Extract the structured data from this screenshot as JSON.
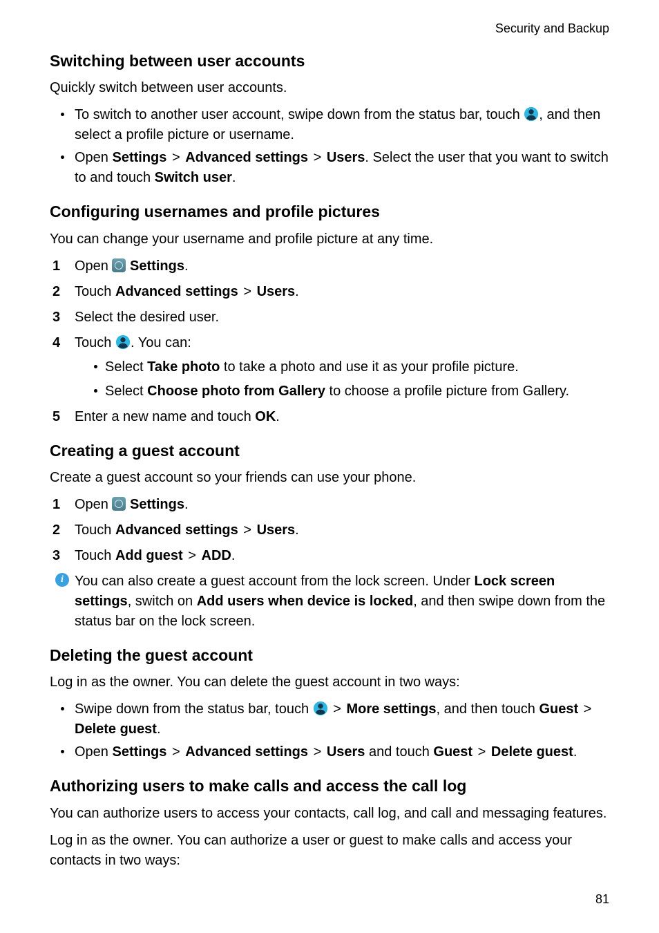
{
  "header": {
    "section": "Security and Backup"
  },
  "page_number": "81",
  "sections": {
    "switching": {
      "title": "Switching between user accounts",
      "intro": "Quickly switch between user accounts.",
      "bullet1_pre": "To switch to another user account, swipe down from the status bar, touch ",
      "bullet1_post": ", and then select a profile picture or username.",
      "bullet2_a": "Open ",
      "bullet2_b": "Settings",
      "bullet2_c": "Advanced settings",
      "bullet2_d": "Users",
      "bullet2_e": ". Select the user that you want to switch to and touch ",
      "bullet2_f": "Switch user",
      "bullet2_g": "."
    },
    "configuring": {
      "title": "Configuring usernames and profile pictures",
      "intro": "You can change your username and profile picture at any time.",
      "step1_a": "Open ",
      "step1_b": "Settings",
      "step1_c": ".",
      "step2_a": "Touch ",
      "step2_b": "Advanced settings",
      "step2_c": "Users",
      "step2_d": ".",
      "step3": "Select the desired user.",
      "step4_a": "Touch ",
      "step4_b": ". You can:",
      "step4_sub1_a": "Select ",
      "step4_sub1_b": "Take photo",
      "step4_sub1_c": " to take a photo and use it as your profile picture.",
      "step4_sub2_a": "Select ",
      "step4_sub2_b": "Choose photo from Gallery",
      "step4_sub2_c": " to choose a profile picture from Gallery.",
      "step5_a": "Enter a new name and touch ",
      "step5_b": "OK",
      "step5_c": "."
    },
    "creating": {
      "title": "Creating a guest account",
      "intro": "Create a guest account so your friends can use your phone.",
      "step1_a": "Open ",
      "step1_b": "Settings",
      "step1_c": ".",
      "step2_a": "Touch ",
      "step2_b": "Advanced settings",
      "step2_c": "Users",
      "step2_d": ".",
      "step3_a": "Touch ",
      "step3_b": "Add guest",
      "step3_c": "ADD",
      "step3_d": ".",
      "note_a": "You can also create a guest account from the lock screen. Under ",
      "note_b": "Lock screen settings",
      "note_c": ", switch on ",
      "note_d": "Add users when device is locked",
      "note_e": ", and then swipe down from the status bar on the lock screen."
    },
    "deleting": {
      "title": "Deleting the guest account",
      "intro": "Log in as the owner. You can delete the guest account in two ways:",
      "bullet1_a": "Swipe down from the status bar, touch ",
      "bullet1_b": "More settings",
      "bullet1_c": ", and then touch ",
      "bullet1_d": "Guest",
      "bullet1_e": "Delete guest",
      "bullet1_f": ".",
      "bullet2_a": "Open ",
      "bullet2_b": "Settings",
      "bullet2_c": "Advanced settings",
      "bullet2_d": "Users",
      "bullet2_e": " and touch ",
      "bullet2_f": "Guest",
      "bullet2_g": "Delete guest",
      "bullet2_h": "."
    },
    "authorizing": {
      "title": "Authorizing users to make calls and access the call log",
      "p1": "You can authorize users to access your contacts, call log, and call and messaging features.",
      "p2": "Log in as the owner. You can authorize a user or guest to make calls and access your contacts in two ways:"
    }
  }
}
